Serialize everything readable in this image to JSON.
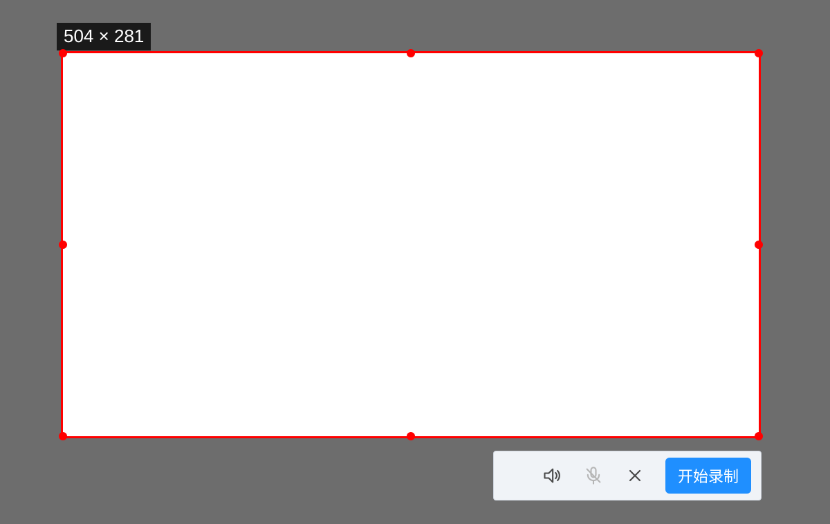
{
  "selection": {
    "dimensions_label": "504 × 281",
    "border_color": "#ff0000",
    "fill_color": "#ffffff"
  },
  "toolbar": {
    "speaker_icon": "speaker-icon",
    "mic_icon": "microphone-muted-icon",
    "close_icon": "close-icon",
    "record_label": "开始录制",
    "background": "#f0f3f7",
    "accent": "#1f8fff"
  }
}
